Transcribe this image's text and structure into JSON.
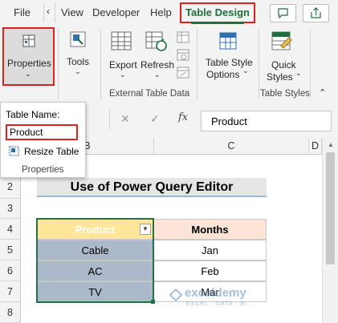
{
  "ribbon_tabs": {
    "file": "File",
    "view": "View",
    "developer": "Developer",
    "help": "Help",
    "table_design": "Table Design"
  },
  "ribbon": {
    "properties": "Properties",
    "tools": "Tools",
    "export": "Export",
    "refresh": "Refresh",
    "table_style_options_1": "Table Style",
    "table_style_options_2": "Options",
    "quick_styles_1": "Quick",
    "quick_styles_2": "Styles",
    "group_external": "External Table Data",
    "group_styles": "Table Styles"
  },
  "properties_popup": {
    "table_name_label": "Table Name:",
    "table_name_value": "Product",
    "resize_table": "Resize Table",
    "group_label": "Properties"
  },
  "formula_bar": {
    "fx": "fx",
    "content": "Product"
  },
  "columns": [
    "B",
    "C",
    "D"
  ],
  "rows": [
    "2",
    "3",
    "4",
    "5",
    "6",
    "7",
    "8"
  ],
  "sheet": {
    "title": "Use of Power Query Editor",
    "headers": [
      "Product",
      "Months"
    ],
    "data": [
      [
        "Cable",
        "Jan"
      ],
      [
        "AC",
        "Feb"
      ],
      [
        "TV",
        "Mar"
      ]
    ]
  },
  "watermark": "exceldemy",
  "watermark_sub": "EXCEL · DATA · BI",
  "colors": {
    "accent_red": "#e0201c",
    "excel_green": "#1d6f3b",
    "product_header_fill": "#ffe699",
    "months_header_fill": "#fce4d6",
    "selected_cell_fill": "#acb9ca"
  }
}
